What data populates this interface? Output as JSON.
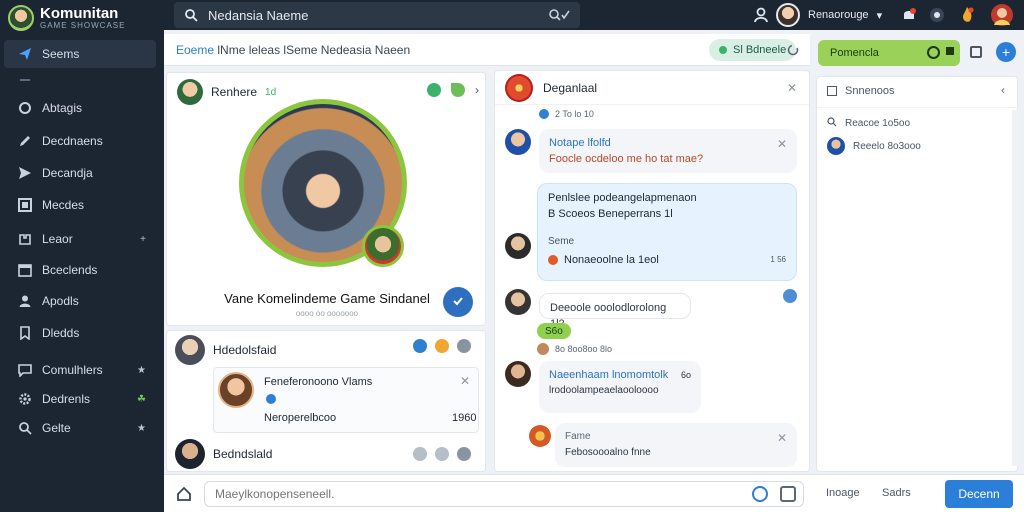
{
  "app": {
    "name": "Komunitan",
    "subtitle": "GAME SHOWCASE"
  },
  "search": {
    "value": "Nedansia Naeme"
  },
  "user": {
    "name": "Renaorouge"
  },
  "sidebar": {
    "items": [
      {
        "label": "Seems",
        "icon": "paper-plane-icon",
        "active": true
      },
      {
        "label": "Abtagis",
        "icon": "circle-icon"
      },
      {
        "label": "Decdnaens",
        "icon": "pen-icon"
      },
      {
        "label": "Decandja",
        "icon": "send-icon"
      },
      {
        "label": "Mecdes",
        "icon": "grid-icon"
      },
      {
        "label": "Leaor",
        "icon": "inbox-icon",
        "right": "+"
      },
      {
        "label": "Bceclends",
        "icon": "calendar-icon"
      },
      {
        "label": "Apodls",
        "icon": "user-icon"
      },
      {
        "label": "Dledds",
        "icon": "bookmark-icon"
      },
      {
        "label": "Comulhlers",
        "icon": "chat-icon",
        "right": "★"
      },
      {
        "label": "Dedrenls",
        "icon": "gear-icon",
        "right": "☘"
      },
      {
        "label": "Gelte",
        "icon": "search-icon",
        "right": "★"
      }
    ]
  },
  "main_header": {
    "lead": "Eoeme",
    "title": "lNme leleas lSeme Nedeasia Naeen",
    "status": "Sl Bdneele"
  },
  "profile": {
    "header_name": "Renhere",
    "header_badge": "1d",
    "name": "Vane Komelindeme Game Sindanel",
    "sub": "oooo oo ooooooo"
  },
  "list": {
    "item1": "Hdedolsfaid",
    "card_title": "Feneferonoono Vlams",
    "card_text": "Neroperelbcoo",
    "card_count": "1960",
    "item2": "Bedndslald"
  },
  "chat": {
    "title": "Deganlaal",
    "date": "2 To lo 10",
    "msg1_title": "Notape lfolfd",
    "msg1_text": "Foocle ocdeloo me ho tat mae?",
    "msg2_line1": "Penlslee podeangelapmenaon",
    "msg2_line2": "B Scoeos Beneperrans 1l",
    "msg2_label": "Seme",
    "msg2_footer": "Nonaeoolne la 1eol",
    "msg2_count": "1 56",
    "msg3_text": "Deeoole ooolodlorolong 1l2",
    "tag": "S6o",
    "reaction_line": "8o 8oo8oo 8lo",
    "msg4_title": "Naeenhaam lnomomtolk",
    "msg4_badge": "6o",
    "msg4_text": "lrodoolampeaelaooloooo",
    "msg5_label": "Fame",
    "msg5_text": "Febosoooalno fnne"
  },
  "right": {
    "filter_label": "Pomencla",
    "heading": "Snnenoos",
    "row1": "Reacoe 1o5oo",
    "row2": "Reeelo 8o3ooo"
  },
  "composer": {
    "placeholder": "Maeylkonopenseneell.",
    "image_label": "Inoage",
    "share_label": "Sadrs",
    "send_label": "Decenn"
  },
  "colors": {
    "sidebar_bg": "#1c2532",
    "accent_blue": "#2b7fd8",
    "accent_green": "#8cc63f"
  }
}
